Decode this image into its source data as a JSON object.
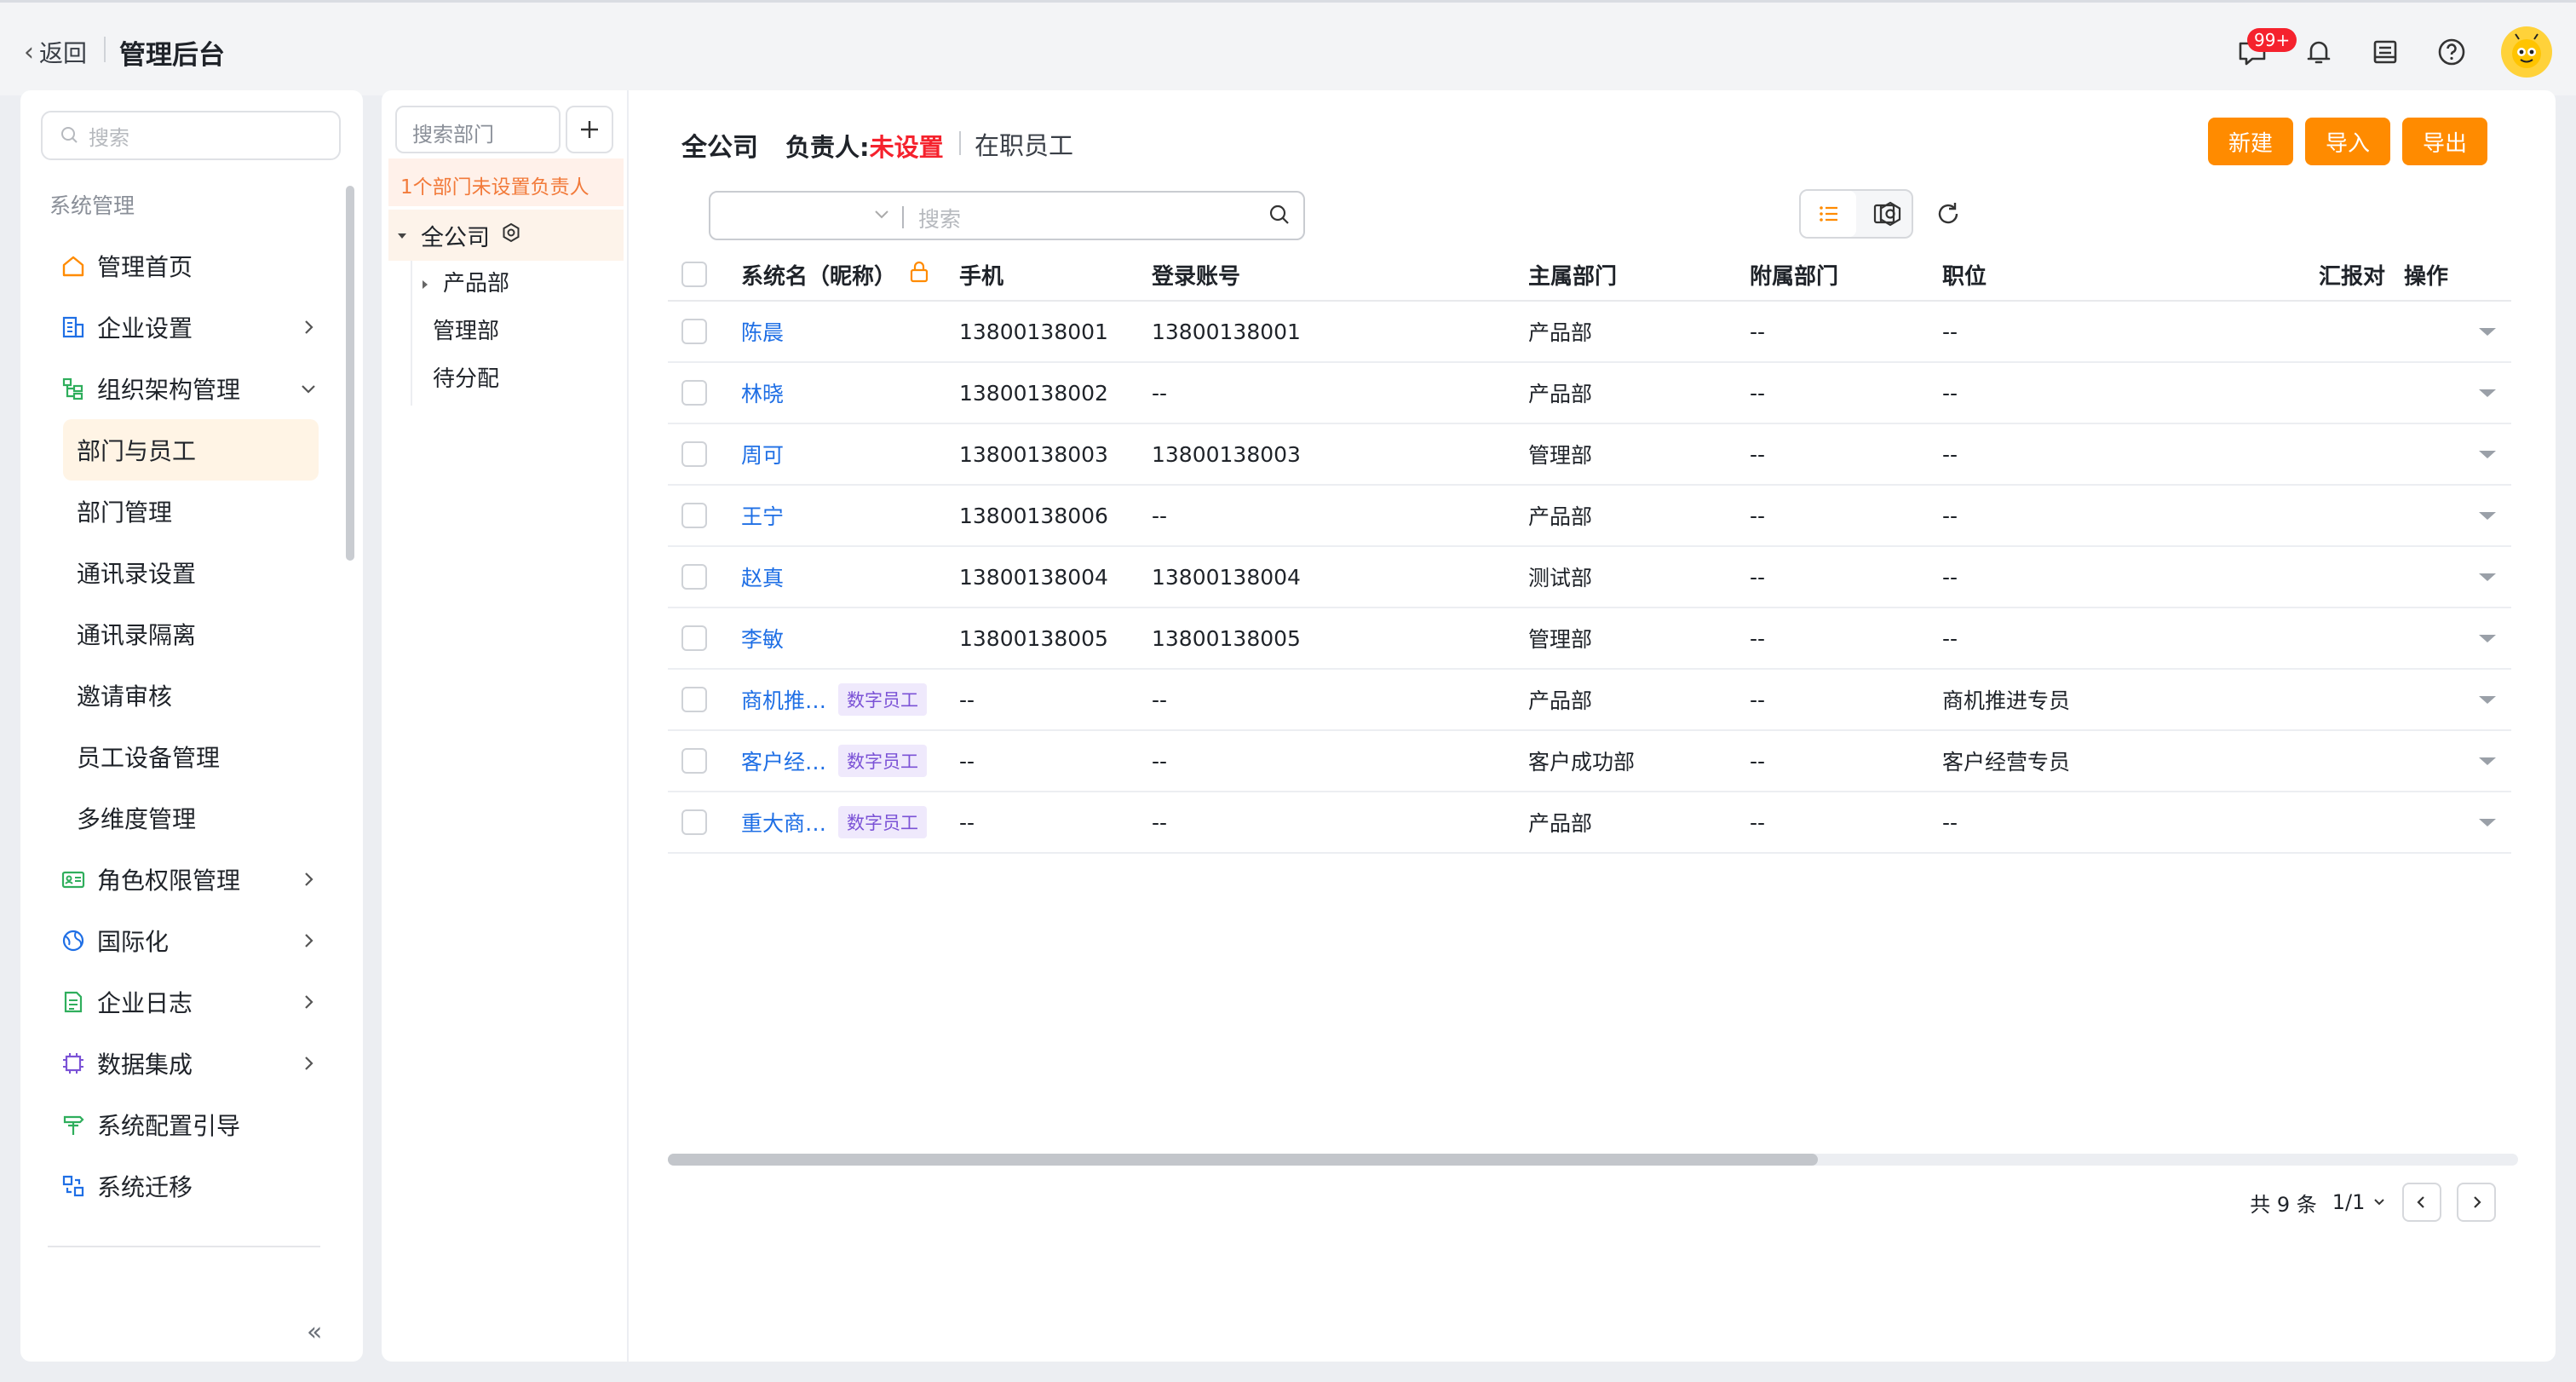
{
  "topbar": {
    "back_label": "返回",
    "app_title": "管理后台",
    "notification_badge": "99+"
  },
  "sidebar": {
    "search_placeholder": "搜索",
    "section_title": "系统管理",
    "items": [
      {
        "label": "管理首页",
        "icon": "home-icon",
        "arrow": ""
      },
      {
        "label": "企业设置",
        "icon": "building-icon",
        "arrow": "right"
      },
      {
        "label": "组织架构管理",
        "icon": "org-tree-icon",
        "arrow": "down"
      },
      {
        "label": "部门与员工",
        "sub": true,
        "active": true
      },
      {
        "label": "部门管理",
        "sub": true
      },
      {
        "label": "通讯录设置",
        "sub": true
      },
      {
        "label": "通讯录隔离",
        "sub": true
      },
      {
        "label": "邀请审核",
        "sub": true
      },
      {
        "label": "员工设备管理",
        "sub": true
      },
      {
        "label": "多维度管理",
        "sub": true
      },
      {
        "label": "角色权限管理",
        "icon": "id-card-icon",
        "arrow": "right"
      },
      {
        "label": "国际化",
        "icon": "globe-icon",
        "arrow": "right"
      },
      {
        "label": "企业日志",
        "icon": "log-icon",
        "arrow": "right"
      },
      {
        "label": "数据集成",
        "icon": "chip-icon",
        "arrow": "right"
      },
      {
        "label": "系统配置引导",
        "icon": "signpost-icon",
        "arrow": ""
      },
      {
        "label": "系统迁移",
        "icon": "migrate-icon",
        "arrow": ""
      }
    ],
    "collapse_label": "«"
  },
  "dept_panel": {
    "search_placeholder": "搜索部门",
    "warning": "1个部门未设置负责人",
    "root": "全公司",
    "children": [
      "产品部",
      "管理部",
      "待分配"
    ]
  },
  "main": {
    "title": "全公司",
    "owner_label": "负责人:",
    "owner_value": "未设置",
    "status": "在职员工",
    "buttons": {
      "new": "新建",
      "import": "导入",
      "export": "导出"
    },
    "search_placeholder": "搜索",
    "columns": [
      "系统名（昵称）",
      "手机",
      "登录账号",
      "主属部门",
      "附属部门",
      "职位",
      "汇报对",
      "操作"
    ],
    "rows": [
      {
        "name": "陈晨",
        "tag": "",
        "phone": "13800138001",
        "account": "13800138001",
        "dept": "产品部",
        "sub": "--",
        "pos": "--"
      },
      {
        "name": "林晓",
        "tag": "",
        "phone": "13800138002",
        "account": "--",
        "dept": "产品部",
        "sub": "--",
        "pos": "--"
      },
      {
        "name": "周可",
        "tag": "",
        "phone": "13800138003",
        "account": "13800138003",
        "dept": "管理部",
        "sub": "--",
        "pos": "--"
      },
      {
        "name": "王宁",
        "tag": "",
        "phone": "13800138006",
        "account": "--",
        "dept": "产品部",
        "sub": "--",
        "pos": "--"
      },
      {
        "name": "赵真",
        "tag": "",
        "phone": "13800138004",
        "account": "13800138004",
        "dept": "测试部",
        "sub": "--",
        "pos": "--"
      },
      {
        "name": "李敏",
        "tag": "",
        "phone": "13800138005",
        "account": "13800138005",
        "dept": "管理部",
        "sub": "--",
        "pos": "--"
      },
      {
        "name": "商机推…",
        "tag": "数字员工",
        "phone": "--",
        "account": "--",
        "dept": "产品部",
        "sub": "--",
        "pos": "商机推进专员"
      },
      {
        "name": "客户经…",
        "tag": "数字员工",
        "phone": "--",
        "account": "--",
        "dept": "客户成功部",
        "sub": "--",
        "pos": "客户经营专员"
      },
      {
        "name": "重大商…",
        "tag": "数字员工",
        "phone": "--",
        "account": "--",
        "dept": "产品部",
        "sub": "--",
        "pos": "--"
      }
    ],
    "pager": {
      "total": "共 9 条",
      "page": "1/1"
    }
  },
  "colors": {
    "accent": "#ff8b00",
    "link": "#1f6fe5",
    "danger": "#f5222d",
    "tag_bg": "#efe9fc",
    "tag_fg": "#7b52d6"
  }
}
